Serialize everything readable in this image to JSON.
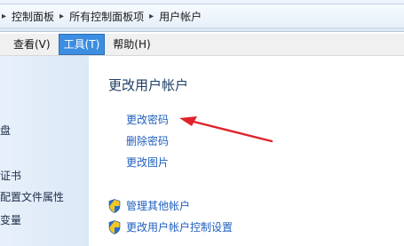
{
  "address_bar": {
    "leading_sep": "▸",
    "crumbs": [
      "控制面板",
      "所有控制面板项",
      "用户帐户"
    ],
    "separator": "▸"
  },
  "menubar": {
    "items": [
      "看(V)",
      "查看(V)",
      "工具(T)",
      "帮助(H)"
    ],
    "active_index": 2
  },
  "left_pane": {
    "items": [
      "盘",
      "证书",
      "配置文件属性",
      "变量"
    ]
  },
  "main": {
    "title": "更改用户帐户",
    "links": [
      "更改密码",
      "删除密码",
      "更改图片"
    ],
    "admin_links": [
      "管理其他帐户",
      "更改用户帐户控制设置"
    ]
  },
  "colors": {
    "link": "#1f5fbf",
    "title": "#1e3f66",
    "menu_active": "#3d8ee0",
    "annotation_arrow": "#e0232b"
  },
  "icons": [
    "shield-icon",
    "annotation-arrow"
  ]
}
